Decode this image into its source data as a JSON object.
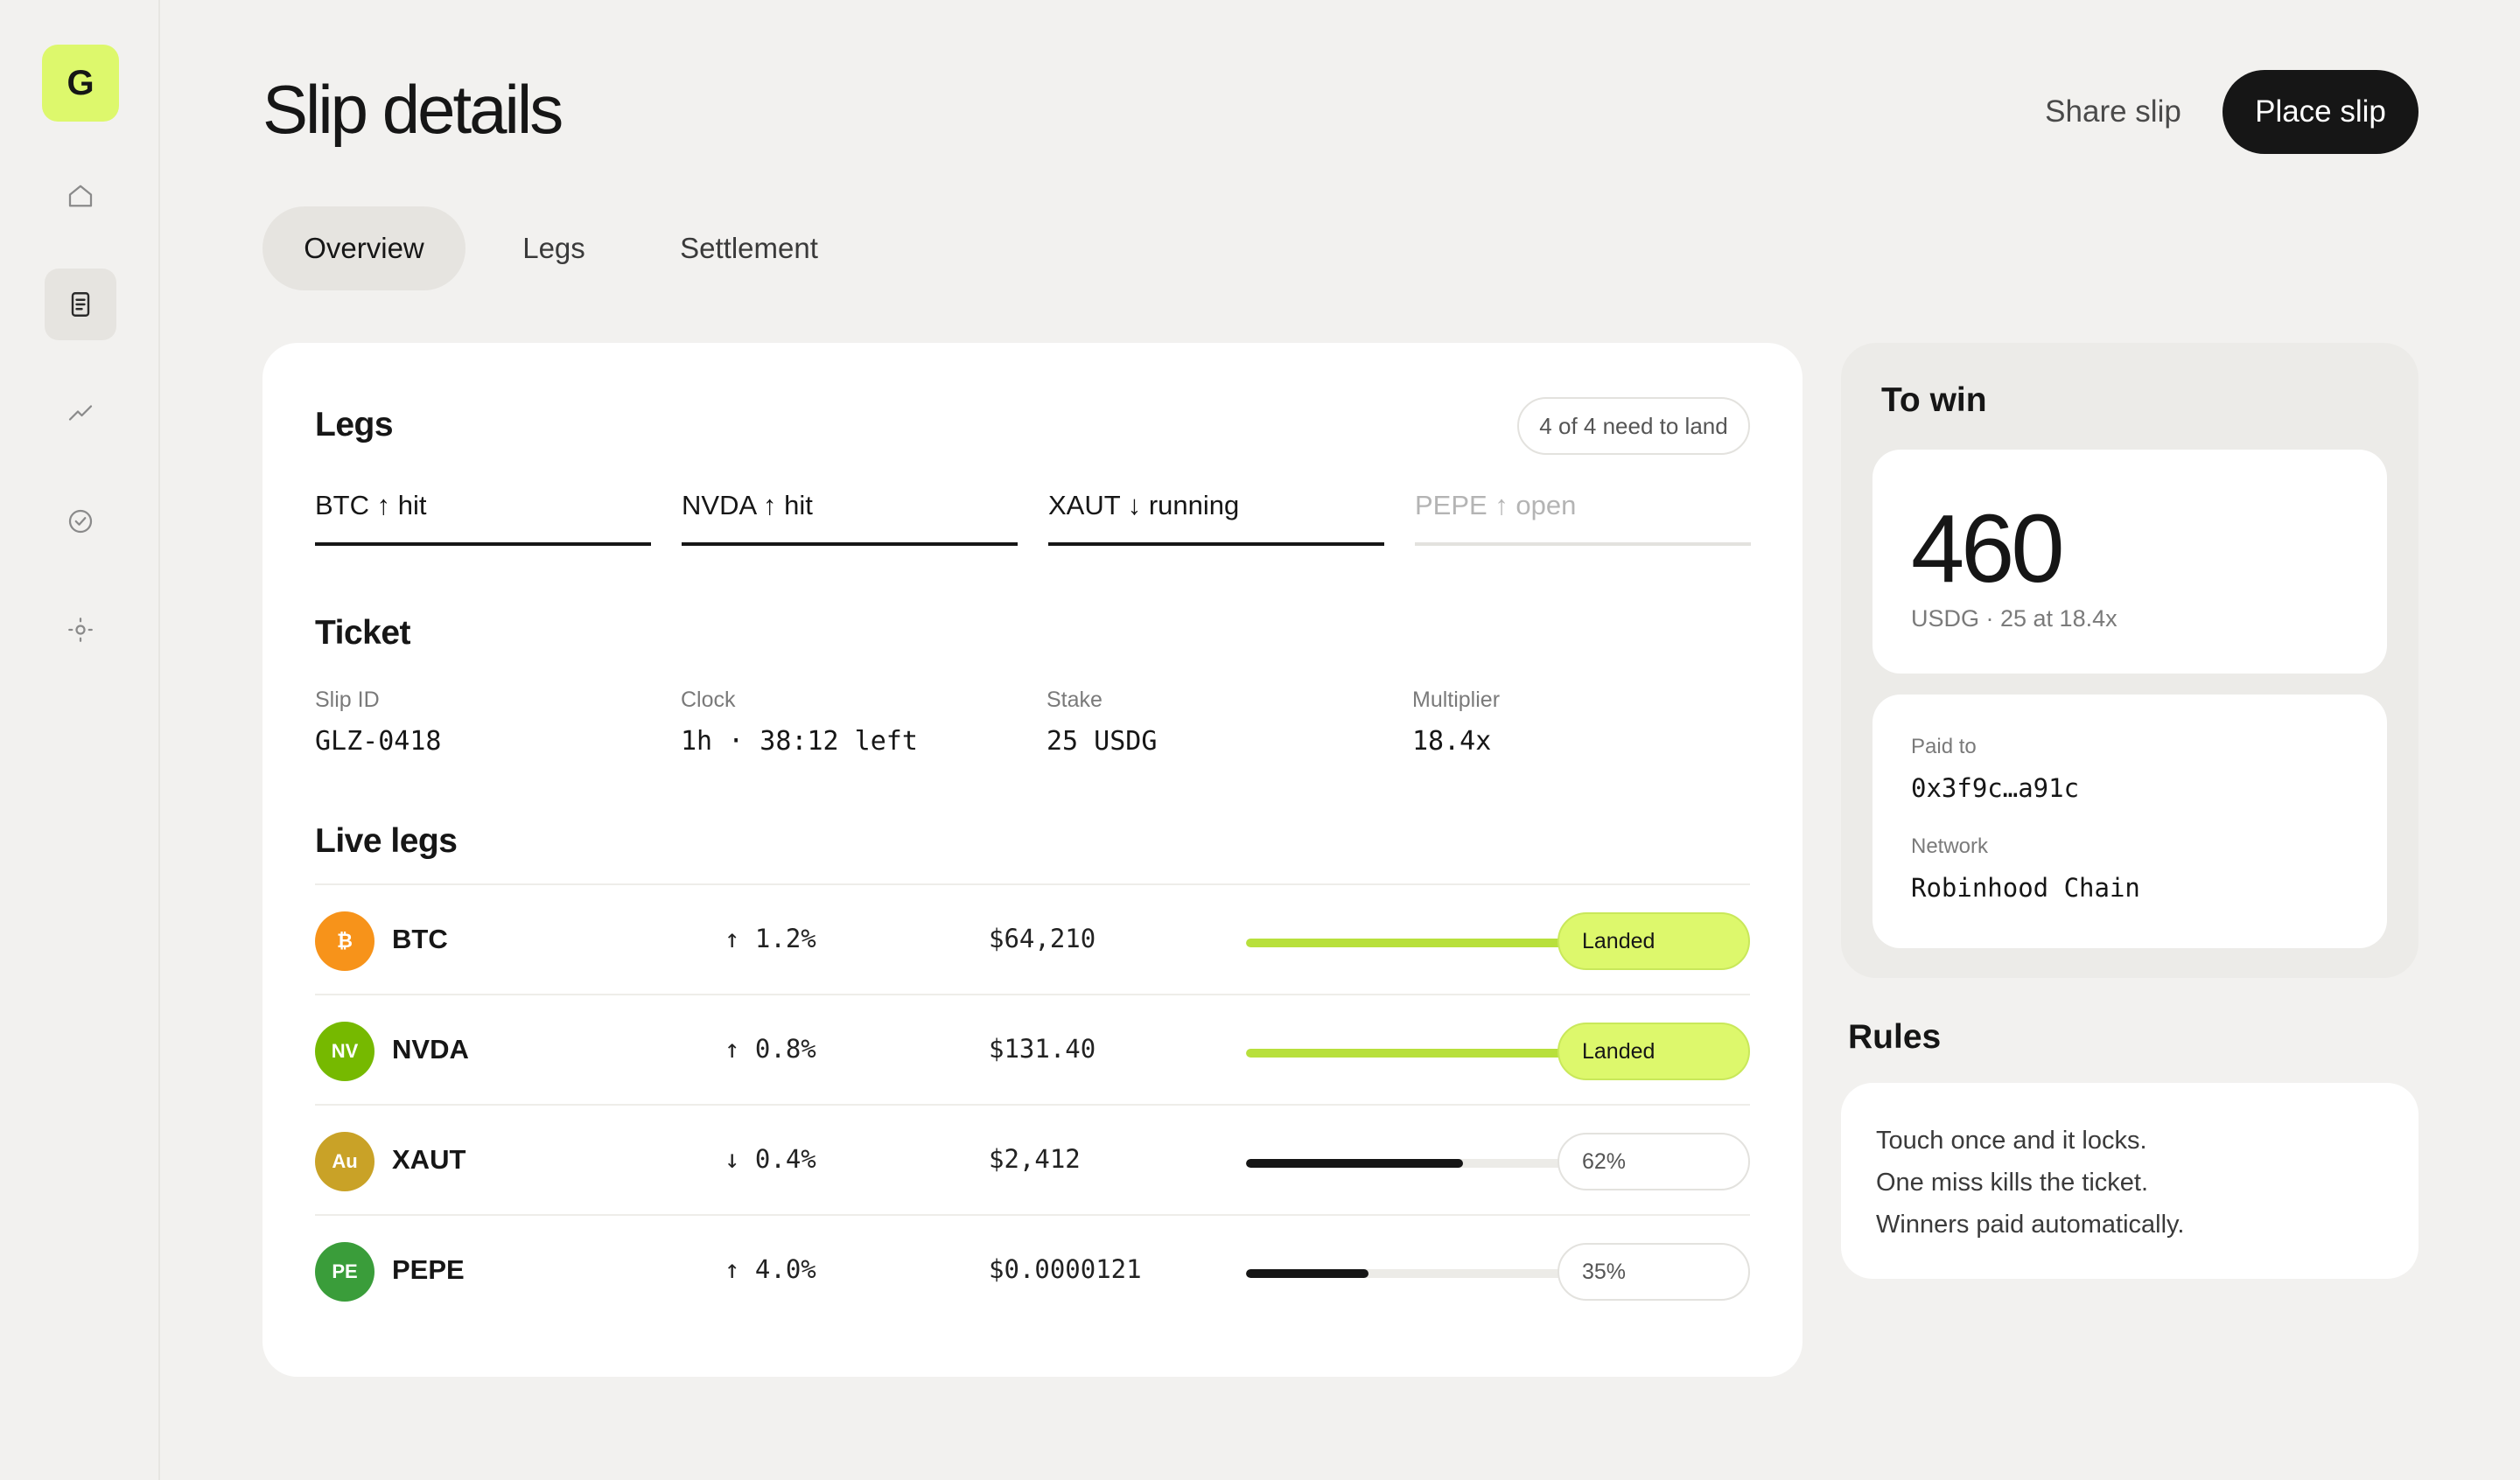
{
  "brand": {
    "logo_letter": "G",
    "accent": "#ddf86c"
  },
  "sidebar": {
    "items": [
      {
        "name": "home",
        "icon": "home-icon",
        "active": false
      },
      {
        "name": "slips",
        "icon": "document-icon",
        "active": true
      },
      {
        "name": "markets",
        "icon": "trend-icon",
        "active": false
      },
      {
        "name": "settled",
        "icon": "check-circle-icon",
        "active": false
      },
      {
        "name": "settings",
        "icon": "sun-gear-icon",
        "active": false
      }
    ]
  },
  "header": {
    "title": "Slip details",
    "share_label": "Share slip",
    "place_label": "Place slip"
  },
  "tabs": [
    {
      "label": "Overview",
      "active": true
    },
    {
      "label": "Legs",
      "active": false
    },
    {
      "label": "Settlement",
      "active": false
    }
  ],
  "legs_section": {
    "title": "Legs",
    "badge": "4 of 4 need to land",
    "legs": [
      {
        "label": "BTC ↑ hit",
        "state": "done"
      },
      {
        "label": "NVDA ↑ hit",
        "state": "done"
      },
      {
        "label": "XAUT ↓ running",
        "state": "active"
      },
      {
        "label": "PEPE ↑ open",
        "state": "open"
      }
    ]
  },
  "ticket": {
    "title": "Ticket",
    "fields": [
      {
        "label": "Slip ID",
        "value": "GLZ-0418"
      },
      {
        "label": "Clock",
        "value": "1h · 38:12 left"
      },
      {
        "label": "Stake",
        "value": "25 USDG"
      },
      {
        "label": "Multiplier",
        "value": "18.4x"
      }
    ]
  },
  "live_legs": {
    "title": "Live legs",
    "rows": [
      {
        "coin_badge": "₿",
        "coin_color": "#f7931a",
        "ticker": "BTC",
        "change": "↑ 1.2%",
        "price": "$64,210",
        "progress": 1.0,
        "bar_color": "#b8e03c",
        "status": "Landed",
        "landed": true
      },
      {
        "coin_badge": "NV",
        "coin_color": "#76b900",
        "ticker": "NVDA",
        "change": "↑ 0.8%",
        "price": "$131.40",
        "progress": 1.0,
        "bar_color": "#b8e03c",
        "status": "Landed",
        "landed": true
      },
      {
        "coin_badge": "Au",
        "coin_color": "#c9a227",
        "ticker": "XAUT",
        "change": "↓ 0.4%",
        "price": "$2,412",
        "progress": 0.62,
        "bar_color": "#161616",
        "status": "62%",
        "landed": false
      },
      {
        "coin_badge": "PE",
        "coin_color": "#3a9d3a",
        "ticker": "PEPE",
        "change": "↑ 4.0%",
        "price": "$0.0000121",
        "progress": 0.35,
        "bar_color": "#161616",
        "status": "35%",
        "landed": false
      }
    ]
  },
  "to_win": {
    "title": "To win",
    "amount": "460",
    "sub": "USDG · 25 at 18.4x",
    "paid_to_label": "Paid to",
    "paid_to_value": "0x3f9c…a91c",
    "network_label": "Network",
    "network_value": "Robinhood Chain"
  },
  "rules": {
    "title": "Rules",
    "lines": [
      "Touch once and it locks.",
      "One miss kills the ticket.",
      "Winners paid automatically."
    ]
  }
}
